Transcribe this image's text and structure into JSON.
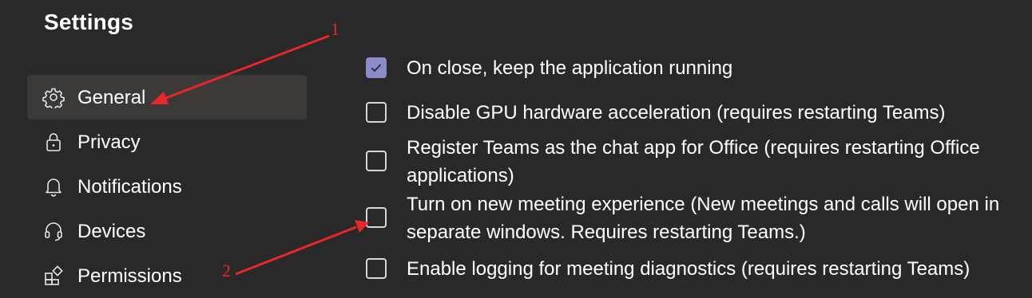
{
  "header": {
    "title": "Settings"
  },
  "sidebar": {
    "items": [
      {
        "label": "General",
        "icon": "gear-icon",
        "selected": true
      },
      {
        "label": "Privacy",
        "icon": "lock-icon",
        "selected": false
      },
      {
        "label": "Notifications",
        "icon": "bell-icon",
        "selected": false
      },
      {
        "label": "Devices",
        "icon": "headset-icon",
        "selected": false
      },
      {
        "label": "Permissions",
        "icon": "apps-icon",
        "selected": false
      }
    ]
  },
  "options": [
    {
      "label": "On close, keep the application running",
      "checked": true
    },
    {
      "label": "Disable GPU hardware acceleration (requires restarting Teams)",
      "checked": false
    },
    {
      "label": "Register Teams as the chat app for Office (requires restarting Office applications)",
      "checked": false
    },
    {
      "label": "Turn on new meeting experience (New meetings and calls will open in separate windows. Requires restarting Teams.)",
      "checked": false
    },
    {
      "label": "Enable logging for meeting diagnostics (requires restarting Teams)",
      "checked": false
    }
  ],
  "annotations": [
    {
      "number": "1"
    },
    {
      "number": "2"
    }
  ],
  "colors": {
    "background": "#292929",
    "selected_item": "#3b3a39",
    "checkbox_checked": "#8b8cc7",
    "annotation": "#e8272a"
  }
}
